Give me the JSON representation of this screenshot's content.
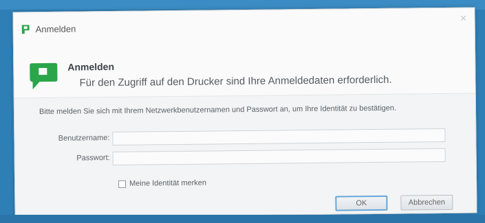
{
  "window": {
    "title": "Anmelden",
    "close_label": "×"
  },
  "header": {
    "title": "Anmelden",
    "subtitle": "Für den Zugriff auf den Drucker sind Ihre Anmeldedaten erforderlich."
  },
  "form": {
    "instructions": "Bitte melden Sie sich mit Ihrem Netzwerkbenutzernamen und Passwort an, um Ihre Identität zu bestätigen.",
    "username_label": "Benutzername:",
    "username_value": "",
    "password_label": "Passwort:",
    "password_value": "",
    "remember_label": "Meine Identität merken",
    "remember_checked": false
  },
  "buttons": {
    "ok_label": "OK",
    "cancel_label": "Abbrechen"
  },
  "colors": {
    "brand": "#2aa54a",
    "background": "#2f7fb7",
    "default_button_border": "#67a7d9"
  },
  "icons": {
    "app": "papercut-logo-icon",
    "close": "close-icon"
  }
}
